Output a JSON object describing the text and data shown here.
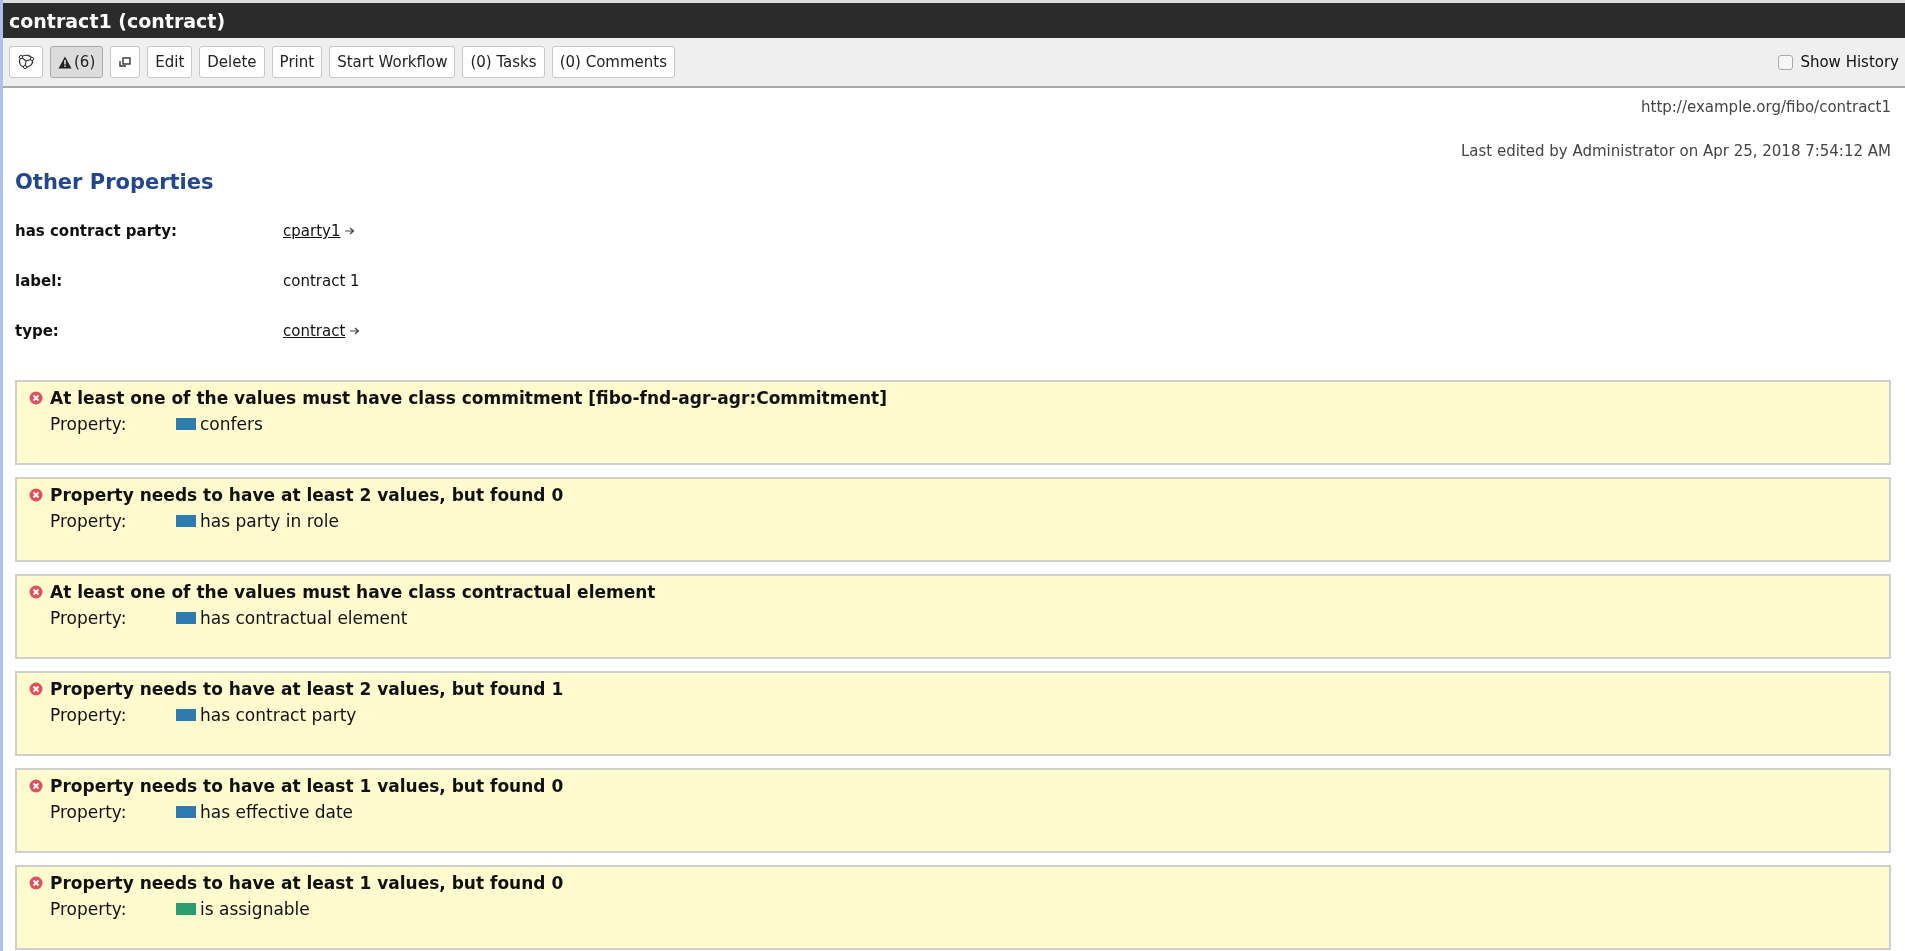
{
  "window": {
    "title": "contract1 (contract)"
  },
  "toolbar": {
    "buttons": [
      {
        "kind": "graph",
        "selected": false
      },
      {
        "kind": "warning",
        "label": "(6)",
        "selected": true
      },
      {
        "kind": "popout",
        "selected": false
      },
      {
        "kind": "text",
        "label": "Edit",
        "selected": false
      },
      {
        "kind": "text",
        "label": "Delete",
        "selected": false
      },
      {
        "kind": "text",
        "label": "Print",
        "selected": false
      },
      {
        "kind": "text",
        "label": "Start Workflow",
        "selected": false
      },
      {
        "kind": "text",
        "label": "(0) Tasks",
        "selected": false
      },
      {
        "kind": "text",
        "label": "(0) Comments",
        "selected": false
      }
    ],
    "show_history": {
      "label": "Show History",
      "checked": false
    }
  },
  "uri": "http://example.org/fibo/contract1",
  "last_edited": "Last edited by Administrator on Apr 25, 2018 7:54:12 AM",
  "section": {
    "title": "Other Properties",
    "properties": [
      {
        "name": "has contract party:",
        "value": "cparty1",
        "kind": "link"
      },
      {
        "name": "label:",
        "value": "contract 1",
        "kind": "literal"
      },
      {
        "name": "type:",
        "value": "contract",
        "kind": "link"
      }
    ]
  },
  "violations": [
    {
      "message": "At least one of the values must have class commitment [fibo-fnd-agr-agr:Commitment]",
      "label": "Property:",
      "property": "confers",
      "color": "#2e7bb0"
    },
    {
      "message": "Property needs to have at least 2 values, but found 0",
      "label": "Property:",
      "property": "has party in role",
      "color": "#2e7bb0"
    },
    {
      "message": "At least one of the values must have class contractual element",
      "label": "Property:",
      "property": "has contractual element",
      "color": "#2e7bb0"
    },
    {
      "message": "Property needs to have at least 2 values, but found 1",
      "label": "Property:",
      "property": "has contract party",
      "color": "#2e7bb0"
    },
    {
      "message": "Property needs to have at least 1 values, but found 0",
      "label": "Property:",
      "property": "has effective date",
      "color": "#2e7bb0"
    },
    {
      "message": "Property needs to have at least 1 values, but found 0",
      "label": "Property:",
      "property": "is assignable",
      "color": "#2a9d6e"
    }
  ]
}
